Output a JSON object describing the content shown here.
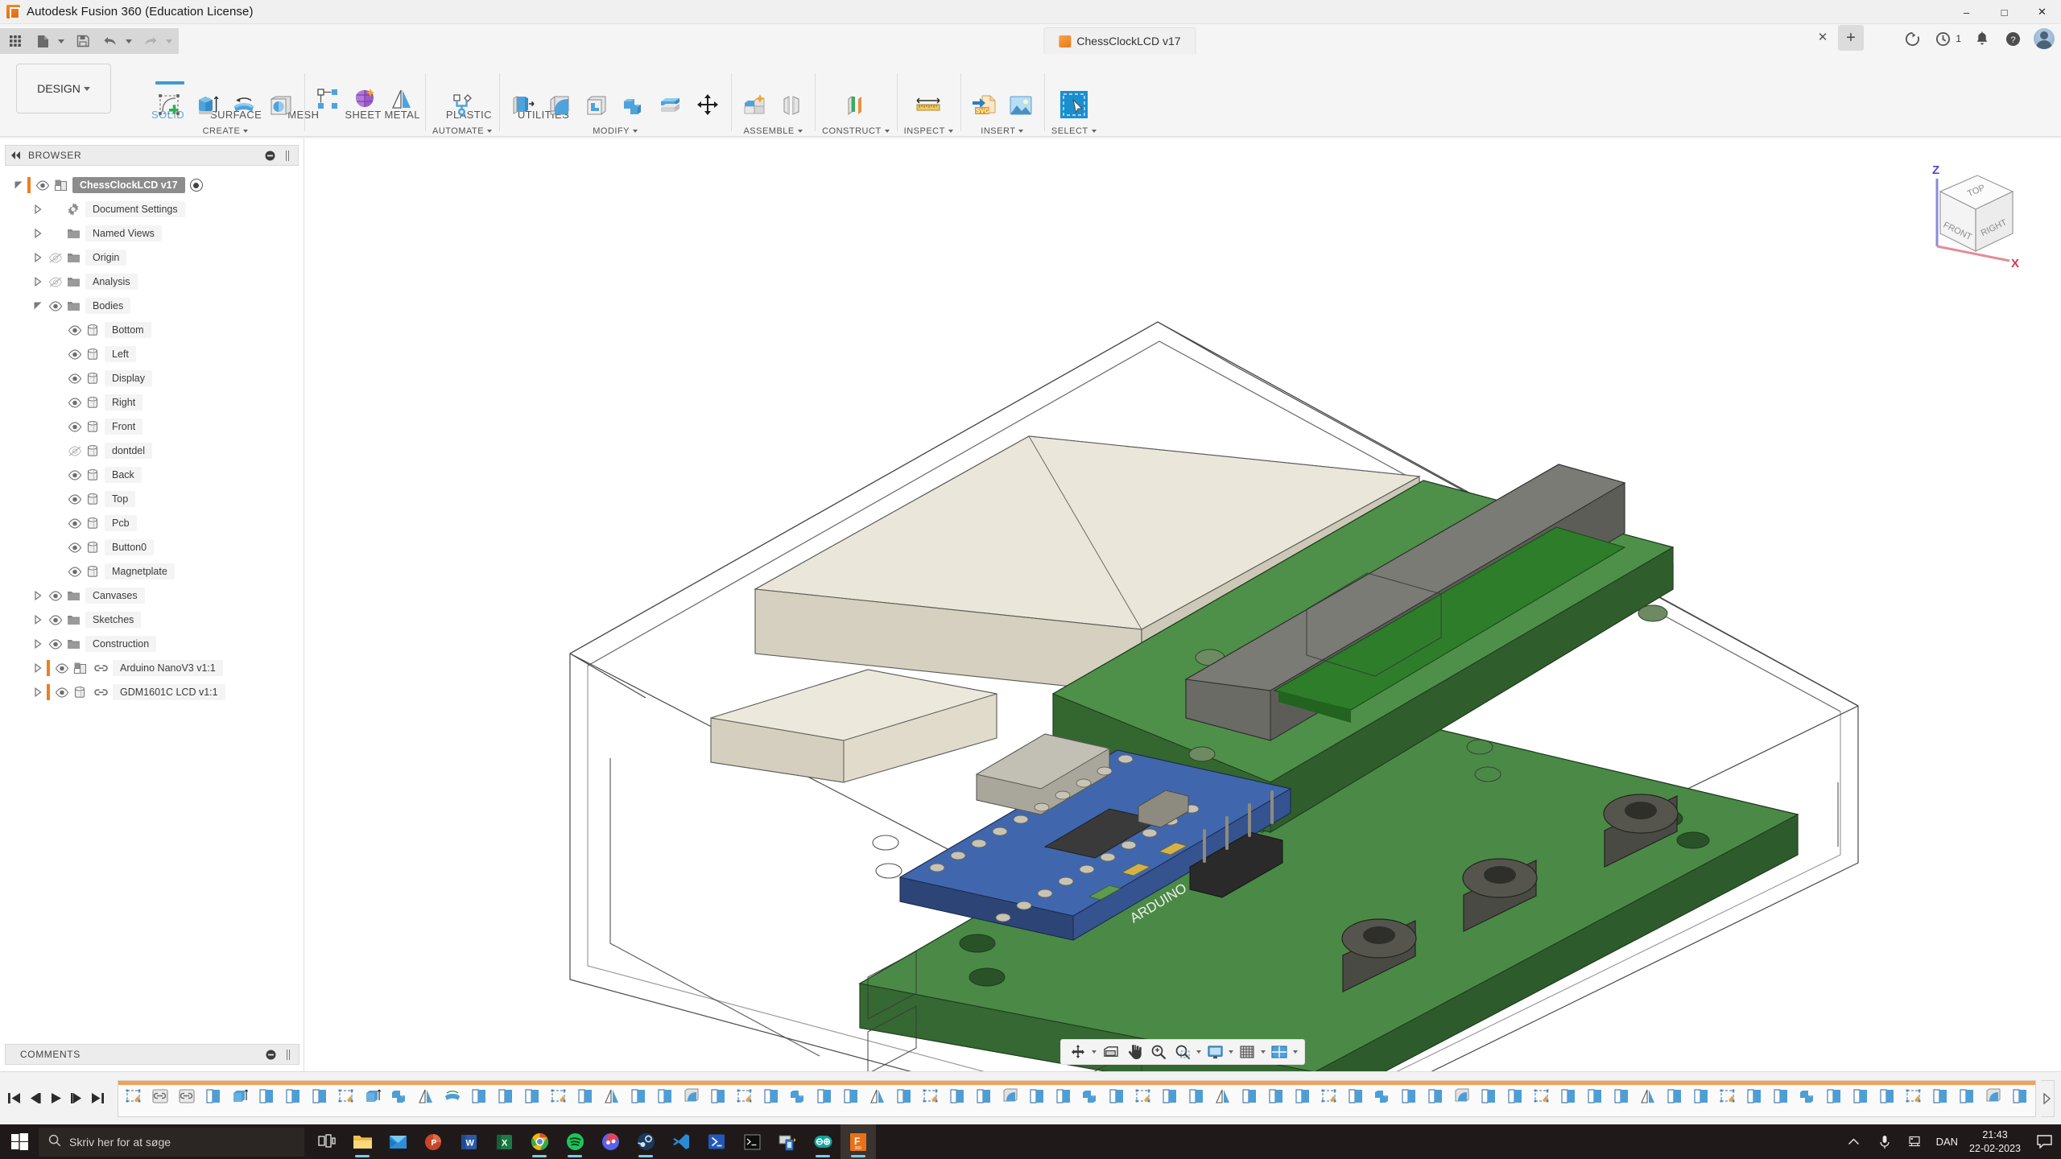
{
  "window": {
    "title": "Autodesk Fusion 360 (Education License)",
    "minimize": "–",
    "maximize": "□",
    "close": "✕"
  },
  "quick_access": {
    "grid": "grid-icon",
    "new": "new-file-icon",
    "save": "save-icon",
    "undo": "undo-icon",
    "redo": "redo-icon"
  },
  "document_tab": {
    "name": "ChessClockLCD v17",
    "close": "✕",
    "new_tab": "+"
  },
  "right_tools": {
    "job_count": "1",
    "refresh": "refresh-icon",
    "jobs": "job-status-icon",
    "notifications": "bell-icon",
    "help": "help-icon",
    "account": "avatar"
  },
  "ribbon": {
    "design_label": "DESIGN",
    "tabs": [
      {
        "label": "SOLID",
        "active": true
      },
      {
        "label": "SURFACE",
        "active": false
      },
      {
        "label": "MESH",
        "active": false
      },
      {
        "label": "SHEET METAL",
        "active": false
      },
      {
        "label": "PLASTIC",
        "active": false
      },
      {
        "label": "UTILITIES",
        "active": false
      }
    ],
    "groups": [
      {
        "label": "CREATE",
        "tools": [
          "create-sketch-icon",
          "extrude-icon",
          "revolve-icon",
          "sphere-icon"
        ]
      },
      {
        "label": "",
        "tools": [
          "pattern-icon",
          "emboss-icon",
          "mirror-icon"
        ]
      },
      {
        "label": "AUTOMATE",
        "tools": [
          "automate-icon"
        ]
      },
      {
        "label": "MODIFY",
        "tools": [
          "press-pull-icon",
          "fillet-icon",
          "shell-icon",
          "combine-icon",
          "split-face-icon",
          "move-copy-icon"
        ]
      },
      {
        "label": "ASSEMBLE",
        "tools": [
          "new-component-icon",
          "joint-icon"
        ]
      },
      {
        "label": "CONSTRUCT",
        "tools": [
          "offset-plane-icon"
        ]
      },
      {
        "label": "INSPECT",
        "tools": [
          "measure-icon"
        ]
      },
      {
        "label": "INSERT",
        "tools": [
          "insert-svg-icon",
          "insert-canvas-icon"
        ]
      },
      {
        "label": "SELECT",
        "tools": [
          "select-icon"
        ]
      }
    ]
  },
  "browser": {
    "title": "BROWSER",
    "collapse_icon": "collapse-left-icon",
    "settings_icon": "panel-settings-icon",
    "resize_icon": "panel-resize-icon",
    "tree": [
      {
        "label": "ChessClockLCD v17",
        "indent": 0,
        "arrow": "open",
        "eye": "visible",
        "icon": "component-icon",
        "selected": true,
        "orange": true,
        "radio": true
      },
      {
        "label": "Document Settings",
        "indent": 1,
        "arrow": "closed",
        "eye": "none",
        "icon": "gear-icon"
      },
      {
        "label": "Named Views",
        "indent": 1,
        "arrow": "closed",
        "eye": "none",
        "icon": "folder-icon"
      },
      {
        "label": "Origin",
        "indent": 1,
        "arrow": "closed",
        "eye": "hidden",
        "icon": "folder-icon"
      },
      {
        "label": "Analysis",
        "indent": 1,
        "arrow": "closed",
        "eye": "hidden",
        "icon": "folder-icon"
      },
      {
        "label": "Bodies",
        "indent": 1,
        "arrow": "open",
        "eye": "visible",
        "icon": "folder-icon"
      },
      {
        "label": "Bottom",
        "indent": 2,
        "arrow": "none",
        "eye": "visible",
        "icon": "body-icon"
      },
      {
        "label": "Left",
        "indent": 2,
        "arrow": "none",
        "eye": "visible",
        "icon": "body-icon"
      },
      {
        "label": "Display",
        "indent": 2,
        "arrow": "none",
        "eye": "visible",
        "icon": "body-icon"
      },
      {
        "label": "Right",
        "indent": 2,
        "arrow": "none",
        "eye": "visible",
        "icon": "body-icon"
      },
      {
        "label": "Front",
        "indent": 2,
        "arrow": "none",
        "eye": "visible",
        "icon": "body-icon"
      },
      {
        "label": "dontdel",
        "indent": 2,
        "arrow": "none",
        "eye": "hidden",
        "icon": "body-icon"
      },
      {
        "label": "Back",
        "indent": 2,
        "arrow": "none",
        "eye": "visible",
        "icon": "body-icon"
      },
      {
        "label": "Top",
        "indent": 2,
        "arrow": "none",
        "eye": "visible",
        "icon": "body-icon"
      },
      {
        "label": "Pcb",
        "indent": 2,
        "arrow": "none",
        "eye": "visible",
        "icon": "body-icon"
      },
      {
        "label": "Button0",
        "indent": 2,
        "arrow": "none",
        "eye": "visible",
        "icon": "body-icon"
      },
      {
        "label": "Magnetplate",
        "indent": 2,
        "arrow": "none",
        "eye": "visible",
        "icon": "body-icon"
      },
      {
        "label": "Canvases",
        "indent": 1,
        "arrow": "closed",
        "eye": "visible",
        "icon": "folder-icon"
      },
      {
        "label": "Sketches",
        "indent": 1,
        "arrow": "closed",
        "eye": "visible",
        "icon": "folder-icon"
      },
      {
        "label": "Construction",
        "indent": 1,
        "arrow": "closed",
        "eye": "visible",
        "icon": "folder-icon"
      },
      {
        "label": "Arduino NanoV3 v1:1",
        "indent": 1,
        "arrow": "closed",
        "eye": "visible",
        "icon": "component-icon",
        "link": true,
        "orange": true
      },
      {
        "label": "GDM1601C LCD v1:1",
        "indent": 1,
        "arrow": "closed",
        "eye": "visible",
        "icon": "body-icon",
        "link": true,
        "orange": true
      }
    ]
  },
  "comments": {
    "title": "COMMENTS",
    "settings_icon": "panel-settings-icon",
    "resize_icon": "panel-resize-icon"
  },
  "viewcube": {
    "top": "TOP",
    "front": "FRONT",
    "right": "RIGHT",
    "axis_z": "Z",
    "axis_x": "X"
  },
  "navbar": {
    "items": [
      "orbit-icon",
      "orbit-dropdown-caret",
      "look-at-icon",
      "pan-icon",
      "zoom-icon",
      "zoom-window-icon",
      "zoom-window-caret",
      "display-settings-icon",
      "display-settings-caret",
      "grid-snaps-icon",
      "grid-snaps-caret",
      "viewports-icon",
      "viewports-caret"
    ]
  },
  "timeline": {
    "playback": [
      "go-to-beginning-icon",
      "step-back-icon",
      "play-icon",
      "step-forward-icon",
      "go-to-end-icon"
    ],
    "features": [
      "sketch-icon",
      "joint-icon",
      "joint-icon",
      "extrude-icon",
      "extrude-thin-icon",
      "extrude-icon",
      "extrude-icon",
      "extrude-icon",
      "sketch-icon",
      "extrude-thin-icon",
      "combine-icon",
      "mirror-icon",
      "revolve-icon",
      "extrude-icon",
      "extrude-icon",
      "extrude-icon",
      "sketch-icon",
      "extrude-icon",
      "mirror-icon",
      "extrude-icon",
      "extrude-icon",
      "fillet-icon",
      "extrude-icon",
      "sketch-icon",
      "extrude-icon",
      "combine-icon",
      "extrude-icon",
      "extrude-icon",
      "mirror-icon",
      "extrude-icon",
      "sketch-icon",
      "extrude-icon",
      "extrude-icon",
      "fillet-icon",
      "extrude-icon",
      "extrude-icon",
      "combine-icon",
      "extrude-icon",
      "sketch-icon",
      "extrude-icon",
      "extrude-icon",
      "mirror-icon",
      "extrude-icon",
      "extrude-icon",
      "extrude-icon",
      "sketch-icon",
      "extrude-icon",
      "combine-icon",
      "extrude-icon",
      "extrude-icon",
      "fillet-icon",
      "extrude-icon",
      "extrude-icon",
      "sketch-icon",
      "extrude-icon",
      "extrude-icon",
      "extrude-icon",
      "mirror-icon",
      "extrude-icon",
      "extrude-icon",
      "sketch-icon",
      "extrude-icon",
      "extrude-icon",
      "combine-icon",
      "extrude-icon",
      "extrude-icon",
      "extrude-icon",
      "sketch-icon",
      "extrude-icon",
      "extrude-icon",
      "fillet-icon",
      "extrude-icon"
    ],
    "end_marker": "timeline-end-icon"
  },
  "taskbar": {
    "start": "windows-start-icon",
    "search_placeholder": "Skriv her for at søge",
    "search_icon": "search-icon",
    "apps": [
      {
        "name": "task-view-icon",
        "running": false
      },
      {
        "name": "file-explorer-icon",
        "running": true
      },
      {
        "name": "mail-icon",
        "running": false
      },
      {
        "name": "powerpoint-icon",
        "running": false
      },
      {
        "name": "word-icon",
        "running": false
      },
      {
        "name": "excel-icon",
        "running": false
      },
      {
        "name": "chrome-icon",
        "running": true
      },
      {
        "name": "spotify-icon",
        "running": true
      },
      {
        "name": "discord-icon",
        "running": false
      },
      {
        "name": "steam-icon",
        "running": true
      },
      {
        "name": "vscode-icon",
        "running": false
      },
      {
        "name": "powershell-icon",
        "running": false
      },
      {
        "name": "terminal-icon",
        "running": false
      },
      {
        "name": "remote-desktop-icon",
        "running": false
      },
      {
        "name": "arduino-icon",
        "running": true
      },
      {
        "name": "fusion360-icon",
        "running": true,
        "active": true
      }
    ],
    "tray": {
      "chevron": "show-hidden-icons-icon",
      "microphone": "microphone-icon",
      "network": "network-icon",
      "language": "DAN",
      "time": "21:43",
      "date": "22-02-2023",
      "action_center": "action-center-icon"
    }
  },
  "colors": {
    "accent": "#3d9ad6",
    "orange": "#ef7d22",
    "pcb_green": "#3f7a3c",
    "arduino_blue": "#3a5f9e",
    "case_beige": "#ddd8c8",
    "lcd_green": "#2d7d2a"
  }
}
